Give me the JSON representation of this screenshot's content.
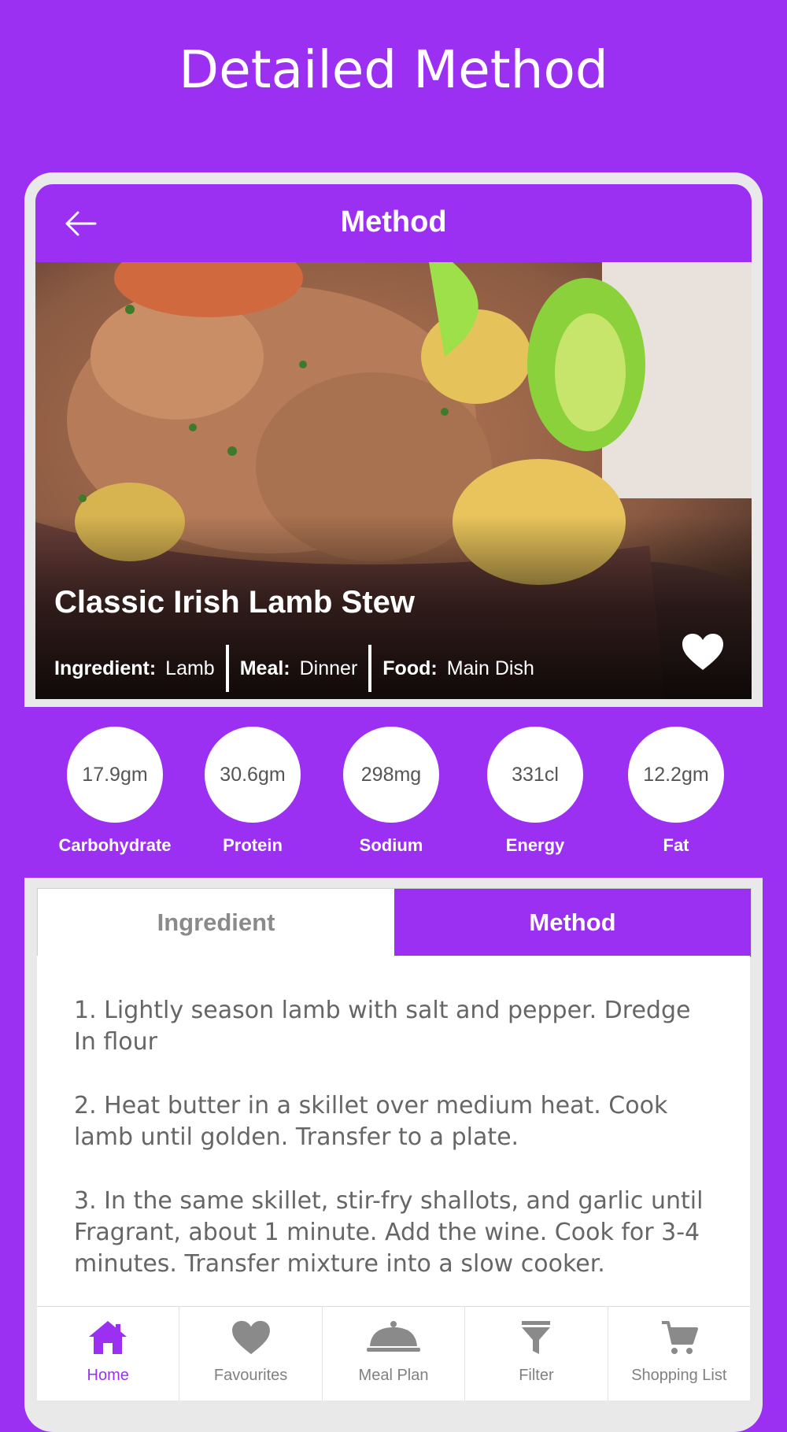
{
  "page_title": "Detailed Method",
  "topbar": {
    "title": "Method",
    "back_icon": "arrow-left-icon"
  },
  "recipe": {
    "title": "Classic Irish Lamb Stew",
    "meta": [
      {
        "key": "Ingredient:",
        "value": "Lamb"
      },
      {
        "key": "Meal:",
        "value": "Dinner"
      },
      {
        "key": "Food:",
        "value": "Main Dish"
      }
    ],
    "favourite_icon": "heart-icon"
  },
  "nutrition": [
    {
      "value": "17.9gm",
      "label": "Carbohydrate"
    },
    {
      "value": "30.6gm",
      "label": "Protein"
    },
    {
      "value": "298mg",
      "label": "Sodium"
    },
    {
      "value": "331cl",
      "label": "Energy"
    },
    {
      "value": "12.2gm",
      "label": "Fat"
    }
  ],
  "tabs": [
    {
      "label": "Ingredient",
      "active": false
    },
    {
      "label": "Method",
      "active": true
    }
  ],
  "steps": [
    "1. Lightly season lamb with salt and pepper. Dredge In flour",
    "2. Heat butter in a skillet over medium heat. Cook lamb until golden. Transfer to a plate.",
    "3. In the same skillet, stir-fry shallots, and garlic until Fragrant, about 1 minute. Add the wine. Cook  for 3-4 minutes. Transfer mixture into a slow cooker."
  ],
  "bottom_nav": [
    {
      "label": "Home",
      "icon": "home-icon",
      "active": true
    },
    {
      "label": "Favourites",
      "icon": "heart-icon",
      "active": false
    },
    {
      "label": "Meal Plan",
      "icon": "cloche-icon",
      "active": false
    },
    {
      "label": "Filter",
      "icon": "filter-icon",
      "active": false
    },
    {
      "label": "Shopping List",
      "icon": "cart-icon",
      "active": false
    }
  ],
  "colors": {
    "accent": "#9b30f3",
    "nav_inactive": "#808080"
  }
}
